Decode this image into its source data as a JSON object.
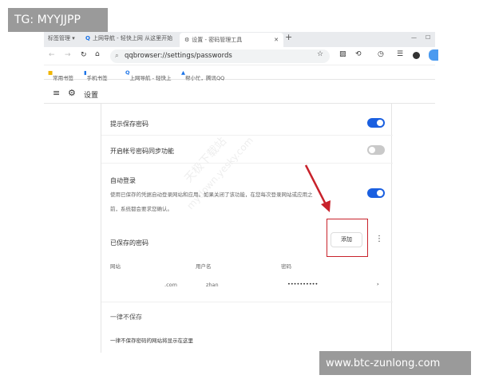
{
  "overlays": {
    "top_left": "TG: MYYJJPP",
    "bottom_right": "www.btc-zunlong.com"
  },
  "watermark": {
    "line1": "天极下载站",
    "line2": "mydown.yesky.com"
  },
  "tabs": [
    {
      "label": "标签管理 ▾"
    },
    {
      "label": "上网导航 - 轻快上网 从这里开始"
    },
    {
      "label": "设置 - 密码管理工具",
      "active": true
    }
  ],
  "address": {
    "url": "qqbrowser://settings/passwords"
  },
  "bookmarks": [
    "常用书签",
    "手机书签",
    "上网导航 - 轻快上",
    "帮小忙，腾讯QQ"
  ],
  "header": {
    "title": "设置"
  },
  "settings": {
    "offer_save": {
      "label": "提示保存密码",
      "on": true
    },
    "sync": {
      "label": "开启帐号密码同步功能",
      "on": false
    },
    "auto_login": {
      "label": "自动登录",
      "desc1": "使用已保存的凭据自动登录网站和应用。如果关闭了该功能，在您每次登录网站或应用之",
      "desc2": "前，系统都会要求您确认。",
      "on": true
    }
  },
  "saved": {
    "title": "已保存的密码",
    "add_label": "添加",
    "columns": {
      "site": "网站",
      "user": "用户名",
      "password": "密码"
    },
    "rows": [
      {
        "site": ".com",
        "user": "zhan",
        "password": "••••••••••"
      }
    ]
  },
  "never": {
    "title": "一律不保存",
    "desc": "一律不保存密码的网站将显示在这里"
  },
  "colors": {
    "accent": "#1a5fe0",
    "highlight": "#c8222b"
  }
}
